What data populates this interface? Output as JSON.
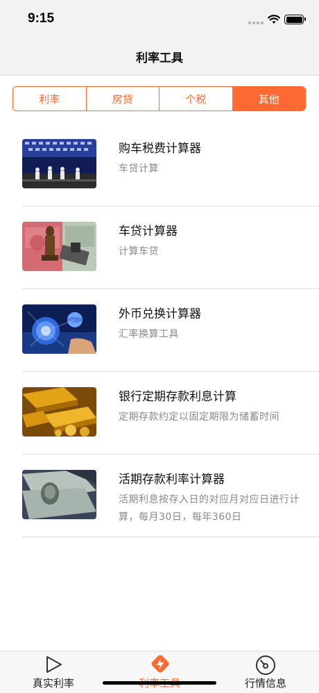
{
  "status": {
    "time": "9:15"
  },
  "nav": {
    "title": "利率工具"
  },
  "segments": [
    {
      "label": "利率"
    },
    {
      "label": "房贷"
    },
    {
      "label": "个税"
    },
    {
      "label": "其他"
    }
  ],
  "active_segment": "其他",
  "items": [
    {
      "title": "购车税费计算器",
      "subtitle": "车贷计算",
      "icon": "conference-stage-photo"
    },
    {
      "title": "车贷计算器",
      "subtitle": "计算车贷",
      "icon": "chess-money-photo"
    },
    {
      "title": "外币兑换计算器",
      "subtitle": "汇率换算工具",
      "icon": "globe-network-photo"
    },
    {
      "title": "银行定期存款利息计算",
      "subtitle": "定期存款约定以固定期限为储蓄时间",
      "icon": "gold-bars-photo"
    },
    {
      "title": "活期存款利率计算器",
      "subtitle": "活期利息按存入日的对应月对应日进行计算，每月30日，每年360日",
      "icon": "dollar-bills-photo"
    }
  ],
  "tabs": [
    {
      "label": "真实利率",
      "icon": "play-icon"
    },
    {
      "label": "利率工具",
      "icon": "bolt-tag-icon"
    },
    {
      "label": "行情信息",
      "icon": "gauge-icon"
    }
  ],
  "active_tab": "利率工具",
  "colors": {
    "accent": "#ff6a33",
    "nav_bg": "#f2f2f2",
    "divider": "#dddddd",
    "subtitle": "#888888"
  }
}
